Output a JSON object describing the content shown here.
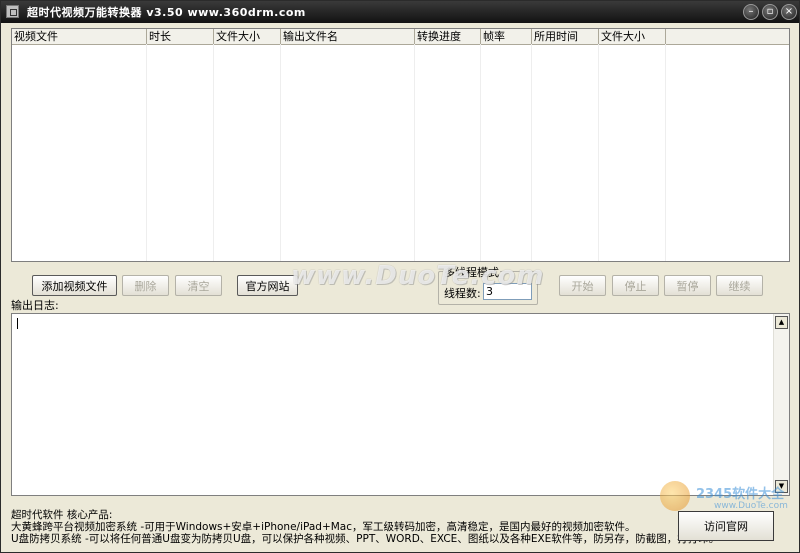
{
  "window": {
    "title": "超时代视频万能转换器 v3.50    www.360drm.com",
    "buttons": [
      "minimize",
      "maximize",
      "close"
    ]
  },
  "file_list": {
    "columns": [
      "视频文件",
      "时长",
      "文件大小",
      "输出文件名",
      "转换进度",
      "帧率",
      "所用时间",
      "文件大小"
    ],
    "rows": []
  },
  "buttons": {
    "add_video": "添加视频文件",
    "delete": "删除",
    "clear": "清空",
    "official_site": "官方网站",
    "start": "开始",
    "stop": "停止",
    "pause": "暂停",
    "resume": "继续",
    "visit_site": "访问官网"
  },
  "threading": {
    "group_title": "多线程模式",
    "thread_label": "线程数:",
    "thread_count": "3"
  },
  "log": {
    "label": "输出日志:",
    "content": ""
  },
  "footer": {
    "line1": "超时代软件 核心产品:",
    "line2": "大黄蜂跨平台视频加密系统 -可用于Windows+安卓+iPhone/iPad+Mac，军工级转码加密，高清稳定，是国内最好的视频加密软件。",
    "line3": "U盘防拷贝系统 -可以将任何普通U盘变为防拷贝U盘，可以保护各种视频、PPT、WORD、EXCE、图纸以及各种EXE软件等，防另存，防截图，打打印。"
  },
  "watermark": {
    "text": "www.DuoTe.com",
    "corner_logo": "2345软件大全",
    "corner_site": "www.DuoTe.com"
  },
  "icons": {
    "app": "app-icon",
    "minimize": "minimize-icon",
    "maximize": "maximize-icon",
    "close": "close-icon",
    "scroll_up": "scroll-up-arrow-icon",
    "scroll_down": "scroll-down-arrow-icon"
  }
}
